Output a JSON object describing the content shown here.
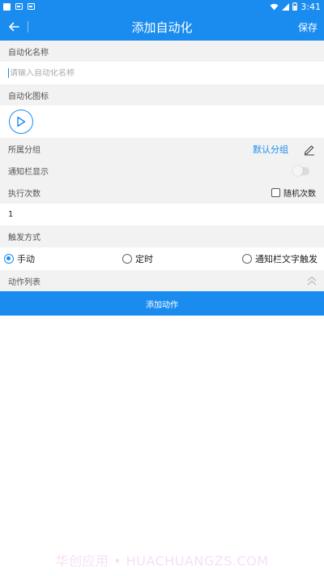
{
  "status_bar": {
    "time": "3:41"
  },
  "header": {
    "title": "添加自动化",
    "save_label": "保存"
  },
  "form": {
    "name_label": "自动化名称",
    "name_placeholder": "请输入自动化名称",
    "name_value": "",
    "icon_label": "自动化图标",
    "group_label": "所属分组",
    "group_value": "默认分组",
    "notify_label": "通知栏显示",
    "notify_enabled": false,
    "exec_label": "执行次数",
    "random_label": "随机次数",
    "random_checked": false,
    "exec_value": "1",
    "trigger_label": "触发方式",
    "trigger_options": [
      {
        "label": "手动",
        "selected": true
      },
      {
        "label": "定时",
        "selected": false
      },
      {
        "label": "通知栏文字触发",
        "selected": false
      }
    ],
    "action_list_label": "动作列表",
    "add_action_label": "添加动作"
  },
  "watermark": "华创应用 • HUACHUANGZS.COM",
  "colors": {
    "primary": "#1a8cf0",
    "section_bg": "#f2f2f2"
  }
}
